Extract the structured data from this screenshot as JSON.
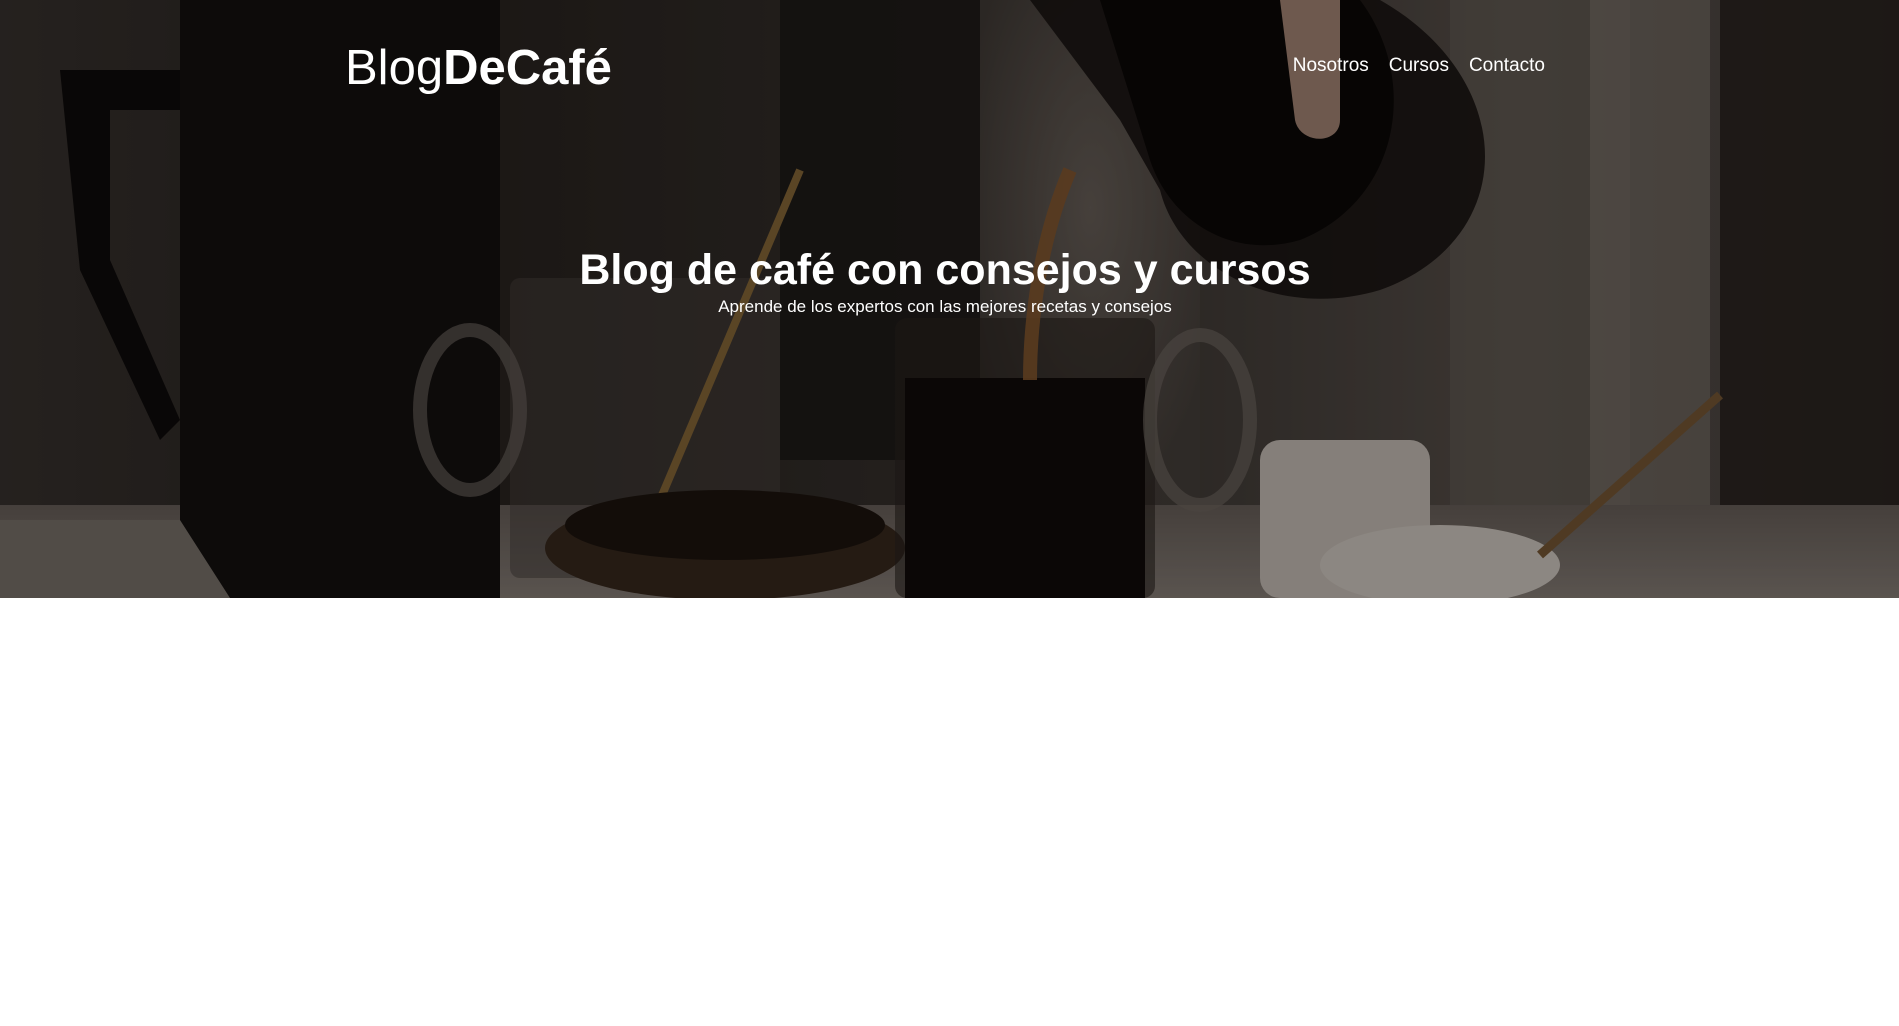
{
  "header": {
    "logo_light": "Blog",
    "logo_bold": "DeCafé",
    "nav": [
      {
        "label": "Nosotros"
      },
      {
        "label": "Cursos"
      },
      {
        "label": "Contacto"
      }
    ]
  },
  "hero": {
    "title": "Blog de café con consejos y cursos",
    "subtitle": "Aprende de los expertos con las mejores recetas y consejos",
    "background_image": "coffee-pouring-photo",
    "overlay_color": "#000000"
  }
}
